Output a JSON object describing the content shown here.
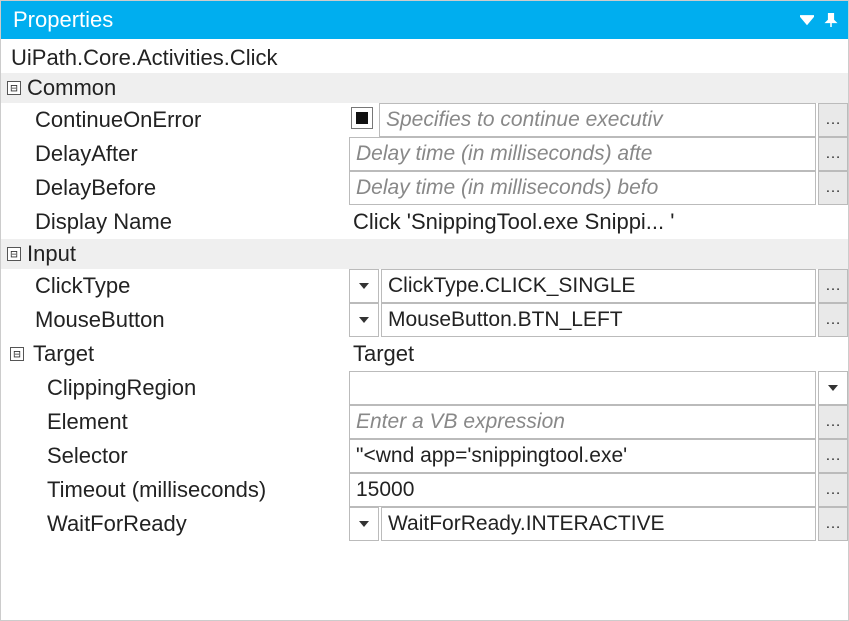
{
  "panel": {
    "title": "Properties"
  },
  "typeName": "UiPath.Core.Activities.Click",
  "categories": {
    "common": {
      "label": "Common",
      "props": {
        "continueOnError": {
          "label": "ContinueOnError",
          "placeholder": "Specifies to continue executiv"
        },
        "delayAfter": {
          "label": "DelayAfter",
          "placeholder": "Delay time (in milliseconds) afte"
        },
        "delayBefore": {
          "label": "DelayBefore",
          "placeholder": "Delay time (in milliseconds) befo"
        },
        "displayName": {
          "label": "Display Name",
          "value": "Click 'SnippingTool.exe Snippi... '"
        }
      }
    },
    "input": {
      "label": "Input",
      "props": {
        "clickType": {
          "label": "ClickType",
          "value": "ClickType.CLICK_SINGLE"
        },
        "mouseButton": {
          "label": "MouseButton",
          "value": "MouseButton.BTN_LEFT"
        }
      }
    },
    "target": {
      "label": "Target",
      "value": "Target",
      "props": {
        "clippingRegion": {
          "label": "ClippingRegion",
          "value": ""
        },
        "element": {
          "label": "Element",
          "placeholder": "Enter a VB expression"
        },
        "selector": {
          "label": "Selector",
          "value": "\"<wnd app='snippingtool.exe' "
        },
        "timeout": {
          "label": "Timeout (milliseconds)",
          "value": "15000"
        },
        "waitForReady": {
          "label": "WaitForReady",
          "value": "WaitForReady.INTERACTIVE"
        }
      }
    }
  }
}
